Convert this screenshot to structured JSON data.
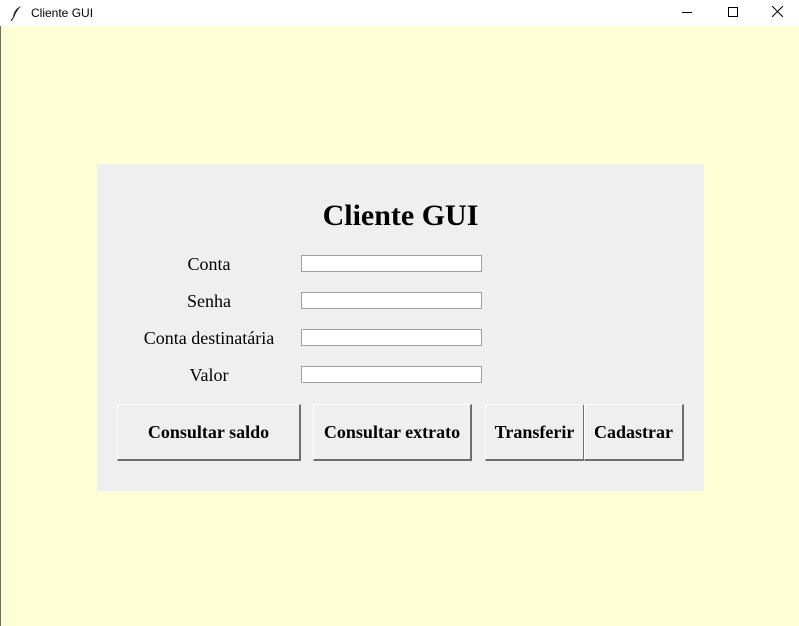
{
  "window": {
    "title": "Cliente GUI",
    "app_icon": "feather-icon",
    "controls": [
      "minimize-icon",
      "maximize-icon",
      "close-icon"
    ]
  },
  "colors": {
    "window_background": "#ffffd6",
    "panel_background": "#efefef",
    "entry_background": "#ffffff"
  },
  "form": {
    "heading": "Cliente GUI",
    "fields": [
      {
        "label": "Conta",
        "value": ""
      },
      {
        "label": "Senha",
        "value": ""
      },
      {
        "label": "Conta destinatária",
        "value": ""
      },
      {
        "label": "Valor",
        "value": ""
      }
    ],
    "buttons": {
      "consultar_saldo": "Consultar saldo",
      "consultar_extrato": "Consultar extrato",
      "transferir": "Transferir",
      "cadastrar": "Cadastrar"
    }
  }
}
